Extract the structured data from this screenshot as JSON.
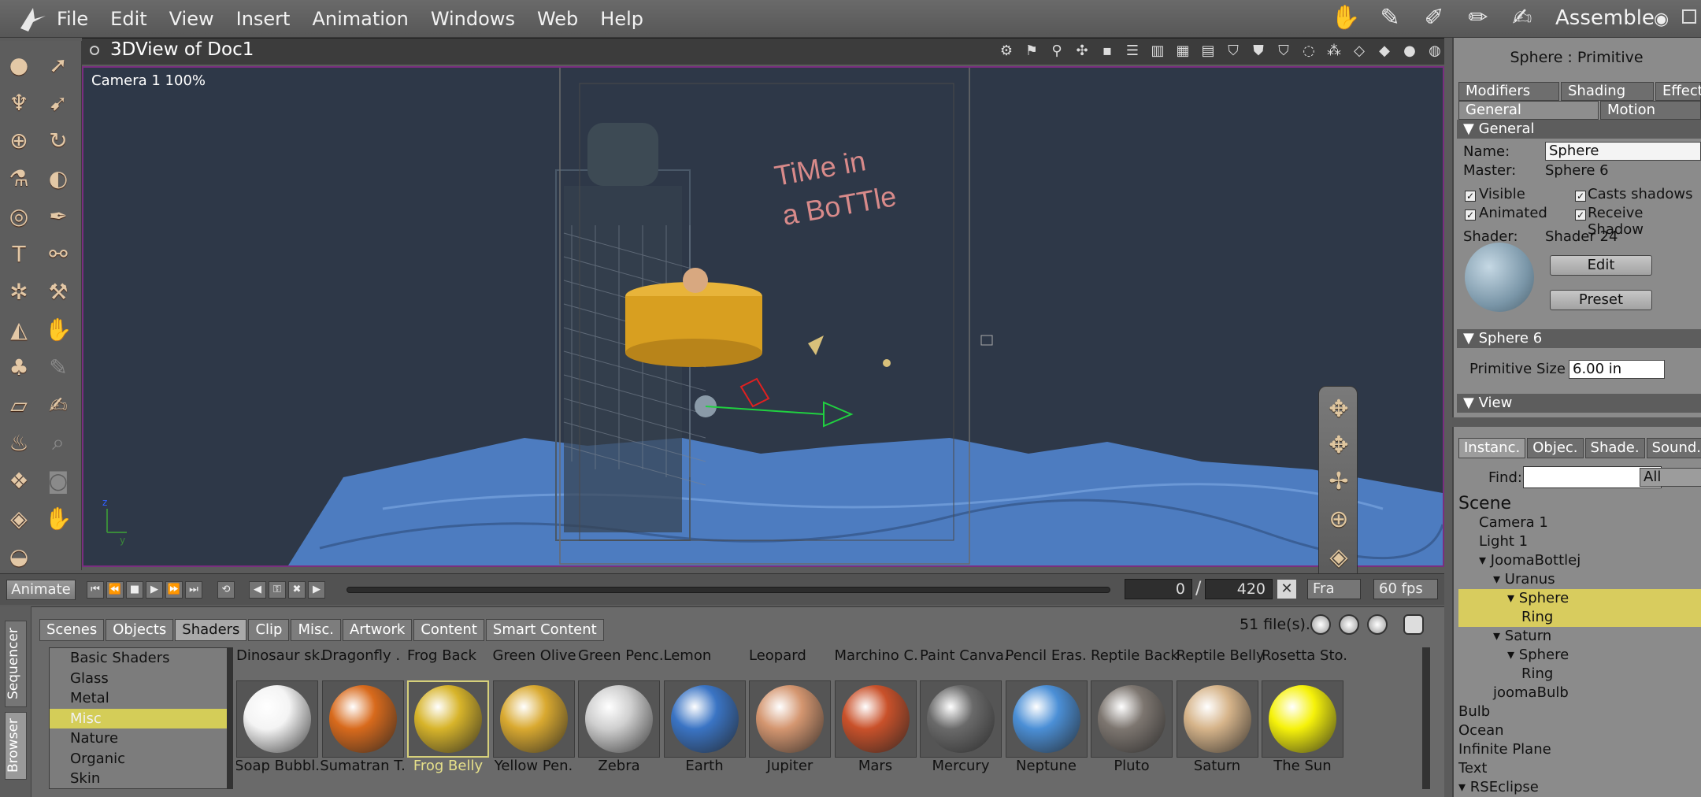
{
  "menubar": {
    "items": [
      "File",
      "Edit",
      "View",
      "Insert",
      "Animation",
      "Windows",
      "Web",
      "Help"
    ],
    "room": "Assemble"
  },
  "viewport": {
    "title": "3DView of Doc1",
    "camera_label": "Camera 1 100%",
    "scene_text": [
      "TiMe in",
      "a BoTTle"
    ]
  },
  "timeline": {
    "animate_label": "Animate",
    "current_frame": "0",
    "separator": "/",
    "end_frame": "420",
    "frame_mode": "Fra",
    "fps": "60 fps"
  },
  "browser": {
    "side_tabs": [
      "Sequencer",
      "Browser"
    ],
    "tabs": [
      "Scenes",
      "Objects",
      "Shaders",
      "Clip",
      "Misc.",
      "Artwork",
      "Content",
      "Smart Content"
    ],
    "active_tab": "Shaders",
    "file_count": "51 file(s).",
    "categories": [
      "Basic Shaders",
      "Glass",
      "Metal",
      "Misc",
      "Nature",
      "Organic",
      "Skin"
    ],
    "selected_category": "Misc",
    "top_row": [
      "Dinosaur sk.",
      "Dragonfly .",
      "Frog Back",
      "Green Olive",
      "Green Penc.",
      "Lemon",
      "Leopard",
      "Marchino C.",
      "Paint Canva.",
      "Pencil Eras.",
      "Reptile Back",
      "Reptile Belly",
      "Rosetta Sto."
    ],
    "items": [
      {
        "name": "Soap Bubbl.",
        "color": "#f4f4f4"
      },
      {
        "name": "Sumatran T.",
        "color": "#d86a1c"
      },
      {
        "name": "Frog Belly",
        "color": "#d7b42a"
      },
      {
        "name": "Yellow Pen.",
        "color": "#d9a930"
      },
      {
        "name": "Zebra",
        "color": "#cfcfcf"
      },
      {
        "name": "Earth",
        "color": "#3a74c4"
      },
      {
        "name": "Jupiter",
        "color": "#d49670"
      },
      {
        "name": "Mars",
        "color": "#c9512a"
      },
      {
        "name": "Mercury",
        "color": "#6a6a6a"
      },
      {
        "name": "Neptune",
        "color": "#4b8fd6"
      },
      {
        "name": "Pluto",
        "color": "#7d7670"
      },
      {
        "name": "Saturn",
        "color": "#d6b48a"
      },
      {
        "name": "The Sun",
        "color": "#f6f20a"
      }
    ],
    "selected_item": "Frog Belly"
  },
  "properties": {
    "title": "Sphere : Primitive",
    "tabs_row1": [
      "Modifiers",
      "Shading",
      "Effects"
    ],
    "tabs_row2": [
      "General",
      "Motion"
    ],
    "section_general": "General",
    "name_label": "Name:",
    "name_value": "Sphere",
    "master_label": "Master:",
    "master_value": "Sphere 6",
    "visible": "Visible",
    "casts_shadows": "Casts shadows",
    "animated": "Animated",
    "receive_shadow": "Receive Shadow",
    "shader_label": "Shader:",
    "shader_value": "Shader 24",
    "edit_btn": "Edit",
    "preset_btn": "Preset",
    "section_sphere": "Sphere 6",
    "primitive_size_label": "Primitive Size",
    "primitive_size_value": "6.00 in",
    "section_view": "View"
  },
  "instances": {
    "tabs": [
      "Instanc.",
      "Objec.",
      "Shade.",
      "Sound."
    ],
    "find_label": "Find:",
    "filter": "All",
    "tree": [
      {
        "label": "Scene",
        "indent": 0,
        "bold": true
      },
      {
        "label": "Camera 1",
        "indent": 1
      },
      {
        "label": "Light 1",
        "indent": 1
      },
      {
        "label": "JoomaBottlej",
        "indent": 1,
        "arrow": true
      },
      {
        "label": "Uranus",
        "indent": 2,
        "arrow": true
      },
      {
        "label": "Sphere",
        "indent": 3,
        "arrow": true,
        "selected": true
      },
      {
        "label": "Ring",
        "indent": 4,
        "selected": true
      },
      {
        "label": "Saturn",
        "indent": 2,
        "arrow": true
      },
      {
        "label": "Sphere",
        "indent": 3,
        "arrow": true
      },
      {
        "label": "Ring",
        "indent": 4
      },
      {
        "label": "joomaBulb",
        "indent": 2
      },
      {
        "label": "Bulb",
        "indent": 0
      },
      {
        "label": "Ocean",
        "indent": 0
      },
      {
        "label": "Infinite Plane",
        "indent": 0
      },
      {
        "label": "Text",
        "indent": 0
      },
      {
        "label": "RSEclipse",
        "indent": 0,
        "arrow": true
      }
    ]
  }
}
